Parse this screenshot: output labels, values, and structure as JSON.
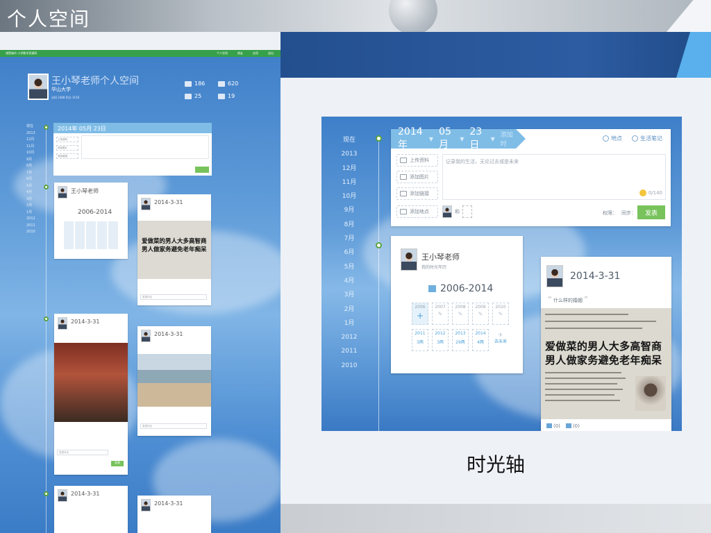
{
  "slide": {
    "title": "个人空间",
    "caption": "时光轴"
  },
  "left": {
    "topbar_brand": "诸暨城市 小学数学资源网",
    "topbar_nav": [
      "个人空间",
      "朋友",
      "应用",
      "退出"
    ],
    "space_title": "王小琴老师个人空间",
    "school": "华山大学",
    "subline": "访问 2468  积分 3150",
    "stats": [
      {
        "icon": "photo-icon",
        "value": "186"
      },
      {
        "icon": "message-icon",
        "value": "620"
      },
      {
        "icon": "doc-icon",
        "value": "25"
      },
      {
        "icon": "cloud-icon",
        "value": "19"
      }
    ],
    "years": [
      "现在",
      "2013",
      "12月",
      "11月",
      "10月",
      "9月",
      "8月",
      "7月",
      "6月",
      "5月",
      "4月",
      "3月",
      "2月",
      "1月",
      "2012",
      "2011",
      "2010"
    ],
    "composer_date": "2014年  05月  23日",
    "composer_buttons": [
      "上传资料",
      "添加图片",
      "添加链接"
    ],
    "composer_placeholder": "记录我的生活，无论过去或是未来",
    "publish": "发表",
    "cards": [
      {
        "title": "王小琴老师",
        "range": "2006-2014"
      },
      {
        "date": "2014-3-31",
        "headline1": "爱做菜的男人大多高智商",
        "headline2": "男人做家务避免老年痴呆"
      },
      {
        "date": "2014-3-31"
      },
      {
        "date": "2014-3-31"
      },
      {
        "date": "2014-3-31"
      },
      {
        "date": "2014-3-31"
      }
    ],
    "comment_placeholder": "发表评论",
    "comment_btn": "发表"
  },
  "right": {
    "years": [
      "现在",
      "2013",
      "12月",
      "11月",
      "10月",
      "9月",
      "8月",
      "7月",
      "6月",
      "5月",
      "4月",
      "3月",
      "2月",
      "1月",
      "2012",
      "2011",
      "2010"
    ],
    "composer": {
      "year": "2014年",
      "month": "05月",
      "day": "23日",
      "action": "添加时",
      "location": "地点",
      "life_note": "生活笔记",
      "buttons": [
        "上传资料",
        "添加图片",
        "添加链接",
        "添加地点"
      ],
      "placeholder": "记录我的生活，无论过去或是未来",
      "counter": "0/140",
      "tag_label": "和",
      "perm_label": "权限：",
      "sync_label": "同步：",
      "publish": "发表"
    },
    "profile": {
      "name": "王小琴老师",
      "subtitle": "我的时光年历",
      "range": "2006-2014",
      "years": [
        {
          "label": "2006",
          "mark": "+",
          "state": "sel"
        },
        {
          "label": "2007",
          "mark": "✎",
          "state": ""
        },
        {
          "label": "2008",
          "mark": "✎",
          "state": ""
        },
        {
          "label": "2009",
          "mark": "✎",
          "state": ""
        },
        {
          "label": "2010",
          "mark": "✎",
          "state": ""
        },
        {
          "label": "2011",
          "mark": "3两",
          "state": "blue"
        },
        {
          "label": "2012",
          "mark": "3两",
          "state": "blue"
        },
        {
          "label": "2013",
          "mark": "29两",
          "state": "blue"
        },
        {
          "label": "2014",
          "mark": "4两",
          "state": "blue"
        },
        {
          "label": "去未来",
          "mark": "✈",
          "state": "more"
        }
      ]
    },
    "news": {
      "date": "2014-3-31",
      "quote": "什么样的婚姻",
      "headline1": "爱做菜的男人大多高智商",
      "headline2": "男人做家务避免老年痴呆",
      "likes": "(0)",
      "comments": "(0)"
    }
  }
}
